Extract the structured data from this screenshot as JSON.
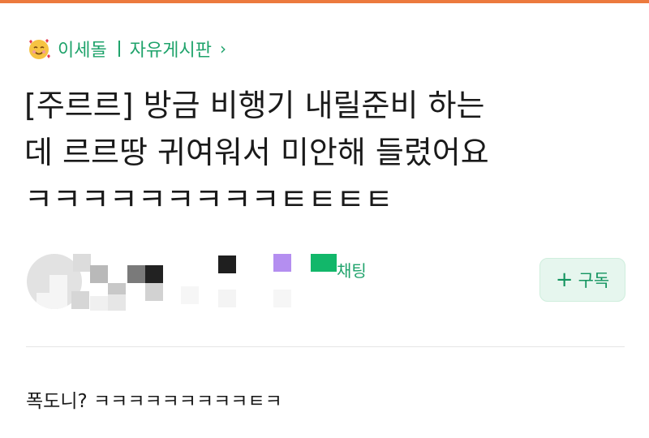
{
  "breadcrumb": {
    "board_owner": "이세돌",
    "board_name": "자유게시판",
    "chevron": "›",
    "emoji_icon": "smiling-face-with-hearts-icon"
  },
  "post": {
    "title_line1": "[주르르] 방금 비행기 내릴준비 하는",
    "title_line2": "데 르르땅 귀여워서 미안해 들렸어요",
    "title_line3": "ㅋㅋㅋㅋㅋㅋㅋㅋㅋㅌㅌㅌㅌ",
    "body": "폭도니? ㅋㅋㅋㅋㅋㅋㅋㅋㅋㅌㅋ"
  },
  "author": {
    "chat_label": "채팅"
  },
  "subscribe": {
    "plus": "+",
    "label": "구독"
  },
  "colors": {
    "accent_green": "#1fa36b",
    "top_bar": "#ec7a3e",
    "subscribe_bg": "#e6f6ee"
  }
}
